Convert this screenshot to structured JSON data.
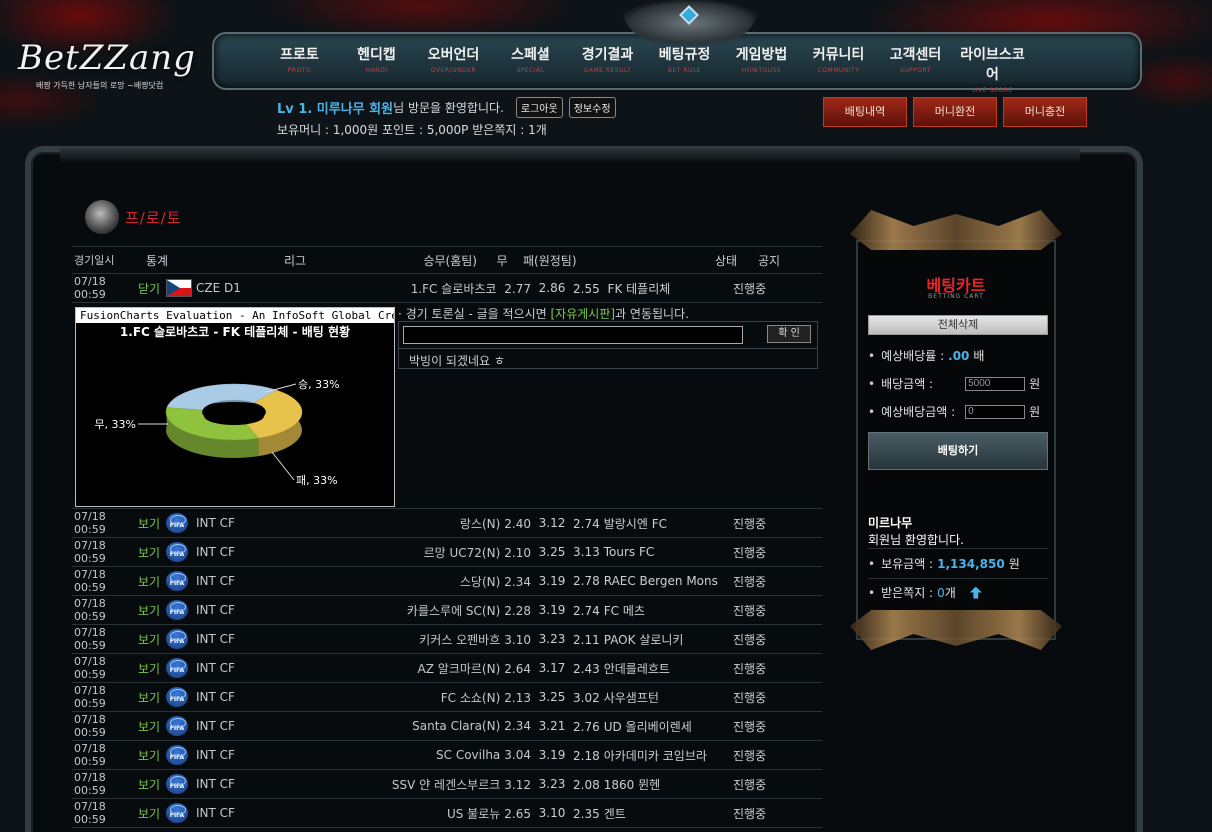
{
  "logo": {
    "text": "BetZZang",
    "tagline": "배짱 가득한 남자들의 로망 ~배짱닷컴"
  },
  "nav": [
    {
      "label": "프로토",
      "sub": "PROTO"
    },
    {
      "label": "헨디캡",
      "sub": "HANDI"
    },
    {
      "label": "오버언더",
      "sub": "OVER/UNDER"
    },
    {
      "label": "스페셜",
      "sub": "SPECIAL"
    },
    {
      "label": "경기결과",
      "sub": "GAME RESULT"
    },
    {
      "label": "베팅규정",
      "sub": "BET RULE"
    },
    {
      "label": "게임방법",
      "sub": "HOWTOUSE"
    },
    {
      "label": "커뮤니티",
      "sub": "COMMUNITY"
    },
    {
      "label": "고객센터",
      "sub": "SUPPORT"
    },
    {
      "label": "라이브스코어",
      "sub": "LIVE SCORE"
    }
  ],
  "user": {
    "level": "Lv 1. 미루나무 회원",
    "welcome": "님 방문을 환영합니다.",
    "logout": "로그아웃",
    "edit": "정보수정",
    "info": "보유머니 : 1,000원 포인트 : 5,000P 받은쪽지 : 1개"
  },
  "actions": {
    "history": "배팅내역",
    "exchange": "머니환전",
    "charge": "머니충전"
  },
  "section": {
    "title": "프/로/토"
  },
  "table": {
    "headers": {
      "date": "경기일시",
      "stat": "통계",
      "league": "리그",
      "home": "승무(홈팀)",
      "draw": "무",
      "away": "패(원정팀)",
      "status": "상태",
      "notice": "공지"
    },
    "first": {
      "date": "07/18 00:59",
      "stat": "닫기",
      "league": "CZE D1",
      "home": "1.FC 슬로바츠코",
      "home_odd": "2.77",
      "draw": "2.86",
      "away_odd": "2.55",
      "away": "FK 테플리체",
      "status": "진행중"
    },
    "rows": [
      {
        "date": "07/18 00:59",
        "stat": "보기",
        "league": "INT CF",
        "home": "랑스(N)",
        "home_odd": "2.40",
        "draw": "3.12",
        "away_odd": "2.74",
        "away": "발랑시엔 FC",
        "status": "진행중"
      },
      {
        "date": "07/18 00:59",
        "stat": "보기",
        "league": "INT CF",
        "home": "르망 UC72(N)",
        "home_odd": "2.10",
        "draw": "3.25",
        "away_odd": "3.13",
        "away": "Tours FC",
        "status": "진행중"
      },
      {
        "date": "07/18 00:59",
        "stat": "보기",
        "league": "INT CF",
        "home": "스당(N)",
        "home_odd": "2.34",
        "draw": "3.19",
        "away_odd": "2.78",
        "away": "RAEC Bergen Mons",
        "status": "진행중"
      },
      {
        "date": "07/18 00:59",
        "stat": "보기",
        "league": "INT CF",
        "home": "카를스루에 SC(N)",
        "home_odd": "2.28",
        "draw": "3.19",
        "away_odd": "2.74",
        "away": "FC 메츠",
        "status": "진행중"
      },
      {
        "date": "07/18 00:59",
        "stat": "보기",
        "league": "INT CF",
        "home": "키커스 오펜바흐",
        "home_odd": "3.10",
        "draw": "3.23",
        "away_odd": "2.11",
        "away": "PAOK 살로니키",
        "status": "진행중"
      },
      {
        "date": "07/18 00:59",
        "stat": "보기",
        "league": "INT CF",
        "home": "AZ 알크마르(N)",
        "home_odd": "2.64",
        "draw": "3.17",
        "away_odd": "2.43",
        "away": "안데를레흐트",
        "status": "진행중"
      },
      {
        "date": "07/18 00:59",
        "stat": "보기",
        "league": "INT CF",
        "home": "FC 소쇼(N)",
        "home_odd": "2.13",
        "draw": "3.25",
        "away_odd": "3.02",
        "away": "사우샘프턴",
        "status": "진행중"
      },
      {
        "date": "07/18 00:59",
        "stat": "보기",
        "league": "INT CF",
        "home": "Santa Clara(N)",
        "home_odd": "2.34",
        "draw": "3.21",
        "away_odd": "2.76",
        "away": "UD 올리베이렌세",
        "status": "진행중"
      },
      {
        "date": "07/18 00:59",
        "stat": "보기",
        "league": "INT CF",
        "home": "SC Covilha",
        "home_odd": "3.04",
        "draw": "3.19",
        "away_odd": "2.18",
        "away": "아카데미카 코임브라",
        "status": "진행중"
      },
      {
        "date": "07/18 00:59",
        "stat": "보기",
        "league": "INT CF",
        "home": "SSV 얀 레겐스부르크",
        "home_odd": "3.12",
        "draw": "3.23",
        "away_odd": "2.08",
        "away": "1860 뮌헨",
        "status": "진행중"
      },
      {
        "date": "07/18 00:59",
        "stat": "보기",
        "league": "INT CF",
        "home": "US 불로뉴",
        "home_odd": "2.65",
        "draw": "3.10",
        "away_odd": "2.35",
        "away": "겐트",
        "status": "진행중"
      }
    ]
  },
  "chart_panel": {
    "eval_text": "FusionCharts Evaluation - An InfoSoft Global Cre",
    "caption": "1.FC 슬로바츠코 - FK 테플리체 - 배팅 현황"
  },
  "chart_data": {
    "type": "pie",
    "categories": [
      "승",
      "무",
      "패"
    ],
    "values": [
      33,
      33,
      33
    ],
    "labels": [
      "승, 33%",
      "무, 33%",
      "패, 33%"
    ],
    "colors": [
      "#a9cbe6",
      "#e8c34c",
      "#8fc23d"
    ],
    "title": "1.FC 슬로바츠코 - FK 테플리체 - 배팅 현황"
  },
  "discussion": {
    "note_pre": "경기 토론실 - 글을 적으시면 ",
    "note_link": "[자유게시판]",
    "note_post": "과 연동됩니다.",
    "ok": "확 인",
    "comment": "박빙이 되겠네요 ㅎ"
  },
  "cart": {
    "title": "베팅카트",
    "subtitle": "BETTING CART",
    "clear": "전체삭제",
    "expected_rate_label": "예상배당률 :",
    "expected_rate": ".00",
    "rate_unit": "배",
    "amount_label": "배당금액 :",
    "amount_value": "5000",
    "won": "원",
    "expected_amount_label": "예상배당금액 :",
    "expected_amount_value": "0",
    "bet": "배팅하기",
    "user_name": "미르나무",
    "user_welcome": "회원님 환영합니다.",
    "balance_label": "보유금액 :",
    "balance": "1,134,850",
    "message_label": "받은쪽지 :",
    "message_count": "0",
    "message_unit": "개"
  }
}
